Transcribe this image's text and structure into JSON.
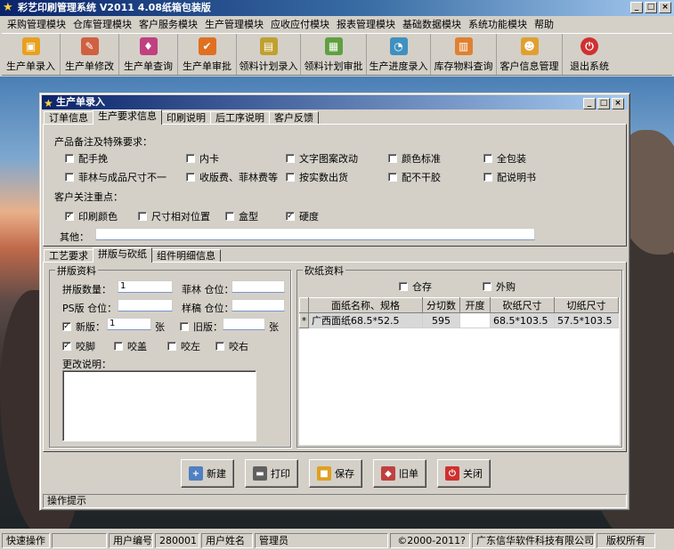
{
  "app": {
    "title": "彩艺印刷管理系统  V2011 4.08纸箱包装版",
    "min_glyph": "_",
    "max_glyph": "□",
    "close_glyph": "×"
  },
  "menu": [
    "采购管理模块",
    "仓库管理模块",
    "客户服务模块",
    "生产管理模块",
    "应收应付模块",
    "报表管理模块",
    "基础数据模块",
    "系统功能模块",
    "帮助"
  ],
  "toolbar": [
    {
      "label": "生产单录入",
      "icon": "order-entry-icon",
      "color": "#e8a020"
    },
    {
      "label": "生产单修改",
      "icon": "order-edit-icon",
      "color": "#d06040"
    },
    {
      "label": "生产单查询",
      "icon": "order-query-icon",
      "color": "#c04080"
    },
    {
      "label": "生产单审批",
      "icon": "order-approve-icon",
      "color": "#e07020"
    },
    {
      "label": "领料计划录入",
      "icon": "material-plan-entry-icon",
      "color": "#c0a030"
    },
    {
      "label": "领料计划审批",
      "icon": "material-plan-approve-icon",
      "color": "#60a040"
    },
    {
      "label": "生产进度录入",
      "icon": "progress-entry-icon",
      "color": "#4090c0"
    },
    {
      "label": "库存物料查询",
      "icon": "inventory-query-icon",
      "color": "#e08030"
    },
    {
      "label": "客户信息管理",
      "icon": "customer-info-icon",
      "color": "#e0a030"
    },
    {
      "label": "退出系统",
      "icon": "exit-icon",
      "color": "#d03030"
    }
  ],
  "window": {
    "title": "生产单录入",
    "top_tabs": [
      "订单信息",
      "生产要求信息",
      "印刷说明",
      "后工序说明",
      "客户反馈"
    ],
    "active_top_tab": 1,
    "requirements": {
      "heading": "产品备注及特殊要求：",
      "row1": [
        {
          "label": "配手挽",
          "checked": false
        },
        {
          "label": "内卡",
          "checked": false
        },
        {
          "label": "文字图案改动",
          "checked": false
        },
        {
          "label": "颜色标准",
          "checked": false
        },
        {
          "label": "全包装",
          "checked": false
        }
      ],
      "row2": [
        {
          "label": "菲林与成品尺寸不一",
          "checked": false
        },
        {
          "label": "收版费、菲林费等",
          "checked": false
        },
        {
          "label": "按实数出货",
          "checked": false
        },
        {
          "label": "配不干胶",
          "checked": false
        },
        {
          "label": "配说明书",
          "checked": false
        }
      ],
      "focus_heading": "客户关注重点：",
      "focus": [
        {
          "label": "印刷颜色",
          "checked": true
        },
        {
          "label": "尺寸相对位置",
          "checked": false
        },
        {
          "label": "盒型",
          "checked": false
        },
        {
          "label": "硬度",
          "checked": true
        }
      ],
      "other_label": "其他：",
      "other_value": ""
    },
    "bottom_tabs": [
      "工艺要求",
      "拼版与砍纸",
      "组件明细信息"
    ],
    "active_bottom_tab": 1,
    "imposition": {
      "group_title": "拼版资料",
      "count_label": "拼版数量：",
      "count_value": "1",
      "film_label": "菲林 仓位：",
      "film_value": "",
      "ps_label": "PS版 仓位：",
      "ps_value": "",
      "sample_label": "样稿 仓位：",
      "sample_value": "",
      "new_label": "新版：",
      "new_checked": true,
      "new_value": "1",
      "new_unit": "张",
      "old_label": "旧版：",
      "old_checked": false,
      "old_value": "",
      "old_unit": "张",
      "grips": [
        {
          "label": "咬脚",
          "checked": true
        },
        {
          "label": "咬盖",
          "checked": false
        },
        {
          "label": "咬左",
          "checked": false
        },
        {
          "label": "咬右",
          "checked": false
        }
      ],
      "change_label": "更改说明："
    },
    "paper": {
      "group_title": "砍纸资料",
      "warehouse": {
        "label": "仓存",
        "checked": false
      },
      "purchase": {
        "label": "外购",
        "checked": false
      },
      "columns": [
        "面纸名称、规格",
        "分切数",
        "开度",
        "砍纸尺寸",
        "切纸尺寸"
      ],
      "rows": [
        {
          "marker": "*",
          "name": "广西面纸68.5*52.5",
          "cuts": "595",
          "open": "",
          "cut_size": "68.5*103.5",
          "trim_size": "57.5*103.5"
        }
      ]
    },
    "buttons": [
      {
        "label": "新建",
        "icon": "new-doc-icon",
        "color": "#5080c0"
      },
      {
        "label": "打印",
        "icon": "printer-icon",
        "color": "#606060"
      },
      {
        "label": "保存",
        "icon": "save-icon",
        "color": "#e0a020"
      },
      {
        "label": "旧单",
        "icon": "old-order-icon",
        "color": "#c04040"
      },
      {
        "label": "关闭",
        "icon": "close-icon",
        "color": "#d03030"
      }
    ],
    "hint_label": "操作提示"
  },
  "status": {
    "quick": "快速操作",
    "user_id_label": "用户编号",
    "user_id": "280001",
    "user_name_label": "用户姓名",
    "user_name": "管理员",
    "copyright": "©2000-2011?",
    "company": "广东信华软件科技有限公司",
    "rights": "版权所有"
  }
}
